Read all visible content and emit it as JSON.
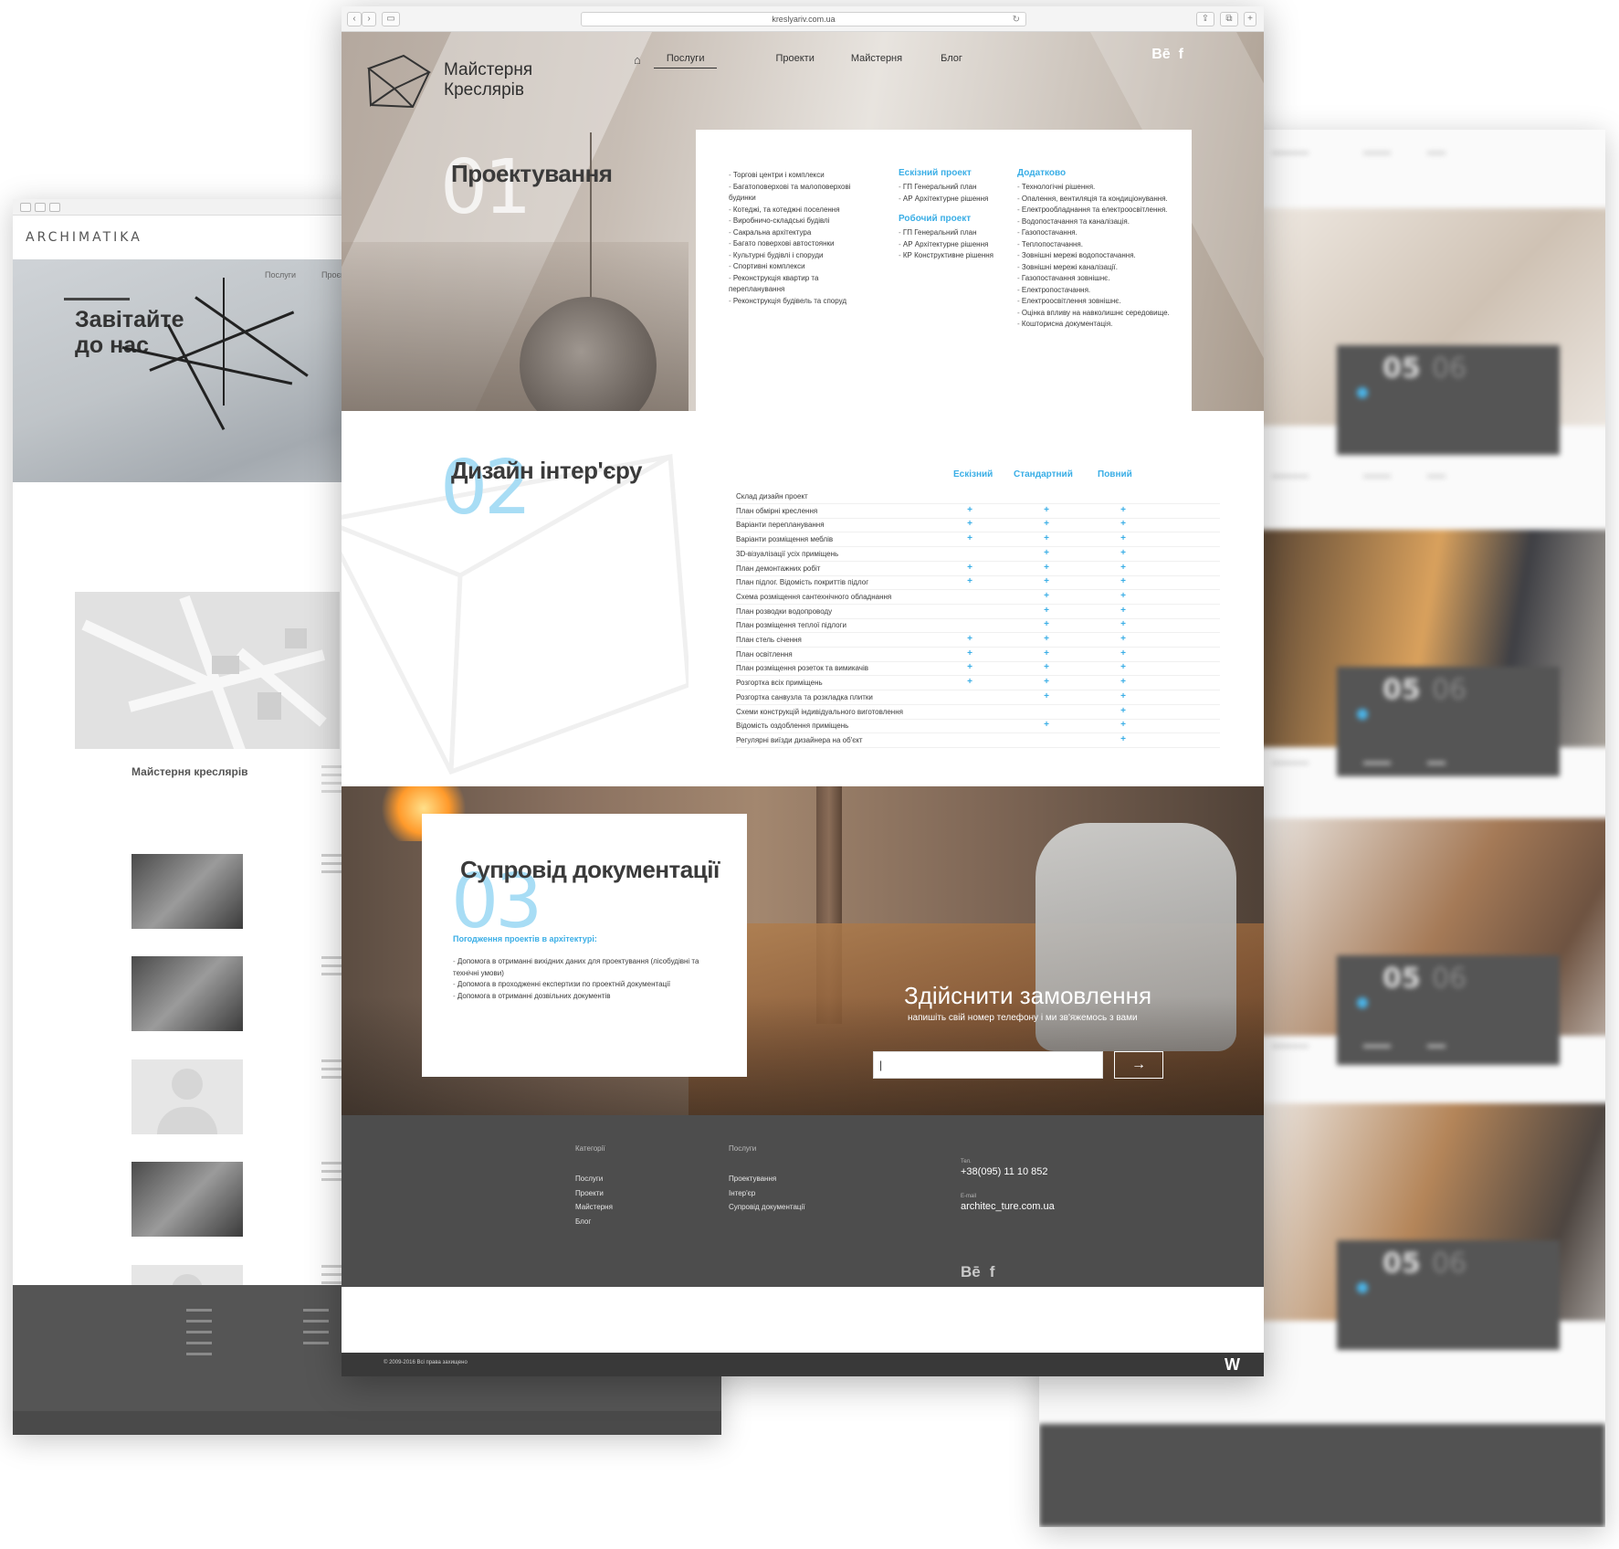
{
  "left_window": {
    "logo": "ARCHIMATIKA",
    "hero_title": "Завітайте до нас",
    "nav": [
      "Послуги",
      "Проєкти"
    ],
    "section_title": "Майстерня креслярів"
  },
  "main_window": {
    "url": "kreslyariv.com.ua",
    "logo_text": "Майстерня Креслярів",
    "nav": {
      "items": [
        {
          "label": "Послуги",
          "active": true
        },
        {
          "label": "Проекти",
          "active": false
        },
        {
          "label": "Майстерня",
          "active": false
        },
        {
          "label": "Блог",
          "active": false
        }
      ]
    },
    "social": {
      "behance": "Bē",
      "facebook": "f"
    },
    "section1": {
      "number": "01",
      "title": "Проектування",
      "items": [
        "Торгові центри і комплекси",
        "Багатоповерхові та малоповерхові будинки",
        "Котеджі, та котеджні поселення",
        "Виробничо-складські будівлі",
        "Сакральна архітектура",
        "Багато поверхові автостоянки",
        "Культурні будівлі і споруди",
        "Спортивні комплекси",
        "Реконструкція квартир та перепланування",
        "Реконструкція будівель та споруд"
      ],
      "sketch": {
        "title": "Ескізний проект",
        "items": [
          "ГП Генеральний план",
          "АР Архітектурне рішення"
        ]
      },
      "working": {
        "title": "Робочий проект",
        "items": [
          "ГП Генеральний план",
          "АР Архітектурне рішення",
          "КР Конструктивне рішення"
        ]
      },
      "extra": {
        "title": "Додатково",
        "items": [
          "Технологічні рішення.",
          "Опалення, вентиляція та кондиціонування.",
          "Електрообладнання та електроосвітлення.",
          "Водопостачання та каналізація.",
          "Газопостачання.",
          "Теплопостачання.",
          "Зовнішні мережі водопостачання.",
          "Зовнішні мережі каналізації.",
          "Газопостачання зовнішнє.",
          "Електропостачання.",
          "Електроосвітлення зовнішнє.",
          "Оцінка впливу на навколишнє середовище.",
          "Кошторисна документація."
        ]
      }
    },
    "section2": {
      "number": "02",
      "title": "Дизайн інтер'єру",
      "columns": [
        "Ескізний",
        "Стандартний",
        "Повний"
      ],
      "rows": [
        {
          "label": "Склад дизайн проект",
          "cells": [
            "",
            "",
            ""
          ]
        },
        {
          "label": "План обмірні креслення",
          "cells": [
            "+",
            "+",
            "+"
          ]
        },
        {
          "label": "Варіанти перепланування",
          "cells": [
            "+",
            "+",
            "+"
          ]
        },
        {
          "label": "Варіанти розміщення меблів",
          "cells": [
            "+",
            "+",
            "+"
          ]
        },
        {
          "label": "3D-візуалізації усіх приміщень",
          "cells": [
            "",
            "+",
            "+"
          ]
        },
        {
          "label": "План демонтажних робіт",
          "cells": [
            "+",
            "+",
            "+"
          ]
        },
        {
          "label": "План підлог. Відомість покриттів підлог",
          "cells": [
            "+",
            "+",
            "+"
          ]
        },
        {
          "label": "Схема розміщення сантехнічного обладнання",
          "cells": [
            "",
            "+",
            "+"
          ]
        },
        {
          "label": "План розводки водопроводу",
          "cells": [
            "",
            "+",
            "+"
          ]
        },
        {
          "label": "План розміщення теплої підлоги",
          "cells": [
            "",
            "+",
            "+"
          ]
        },
        {
          "label": "План стель січення",
          "cells": [
            "+",
            "+",
            "+"
          ]
        },
        {
          "label": "План освітлення",
          "cells": [
            "+",
            "+",
            "+"
          ]
        },
        {
          "label": "План розміщення розеток та вимикачів",
          "cells": [
            "+",
            "+",
            "+"
          ]
        },
        {
          "label": "Розгортка всіх приміщень",
          "cells": [
            "+",
            "+",
            "+"
          ]
        },
        {
          "label": "Розгортка санвузла та розкладка плитки",
          "cells": [
            "",
            "+",
            "+"
          ]
        },
        {
          "label": "Схеми конструкцій індивідуального виготовлення",
          "cells": [
            "",
            "",
            "+"
          ]
        },
        {
          "label": "Відомість оздоблення приміщень",
          "cells": [
            "",
            "+",
            "+"
          ]
        },
        {
          "label": "Регулярні виїзди дизайнера на об'єкт",
          "cells": [
            "",
            "",
            "+"
          ]
        }
      ]
    },
    "section3": {
      "number": "03",
      "title": "Супровід документації",
      "subtitle": "Погодження проектів в архітектурі:",
      "items": [
        "Допомога в отриманні вихідних даних для проектування (лісобудівні та технічні умови)",
        "Допомога в проходженні експертизи по проектній документації",
        "Допомога в отриманні дозвільних документів"
      ]
    },
    "order": {
      "title": "Здійснити замовлення",
      "subtitle": "напишіть свій номер телефону і ми зв'яжемось з вами",
      "input_value": "|",
      "button": "→"
    },
    "footer": {
      "categories_title": "Категорії",
      "categories": [
        "Послуги",
        "Проекти",
        "Майстерня",
        "Блог"
      ],
      "services_title": "Послуги",
      "services": [
        "Проектування",
        "Інтер'єр",
        "Супровід документації"
      ],
      "phone_label": "Тел.",
      "phone": "+38(095) 11 10 852",
      "email_label": "E-mail",
      "email": "architec_ture.com.ua",
      "copyright": "© 2009-2016 Всі права захищено",
      "brand": "W"
    }
  },
  "right_window": {
    "card_numbers": [
      "05",
      "06"
    ]
  },
  "colors": {
    "accent": "#3aaee6",
    "footer": "#4d4d4d",
    "text": "#3a3a3a"
  }
}
